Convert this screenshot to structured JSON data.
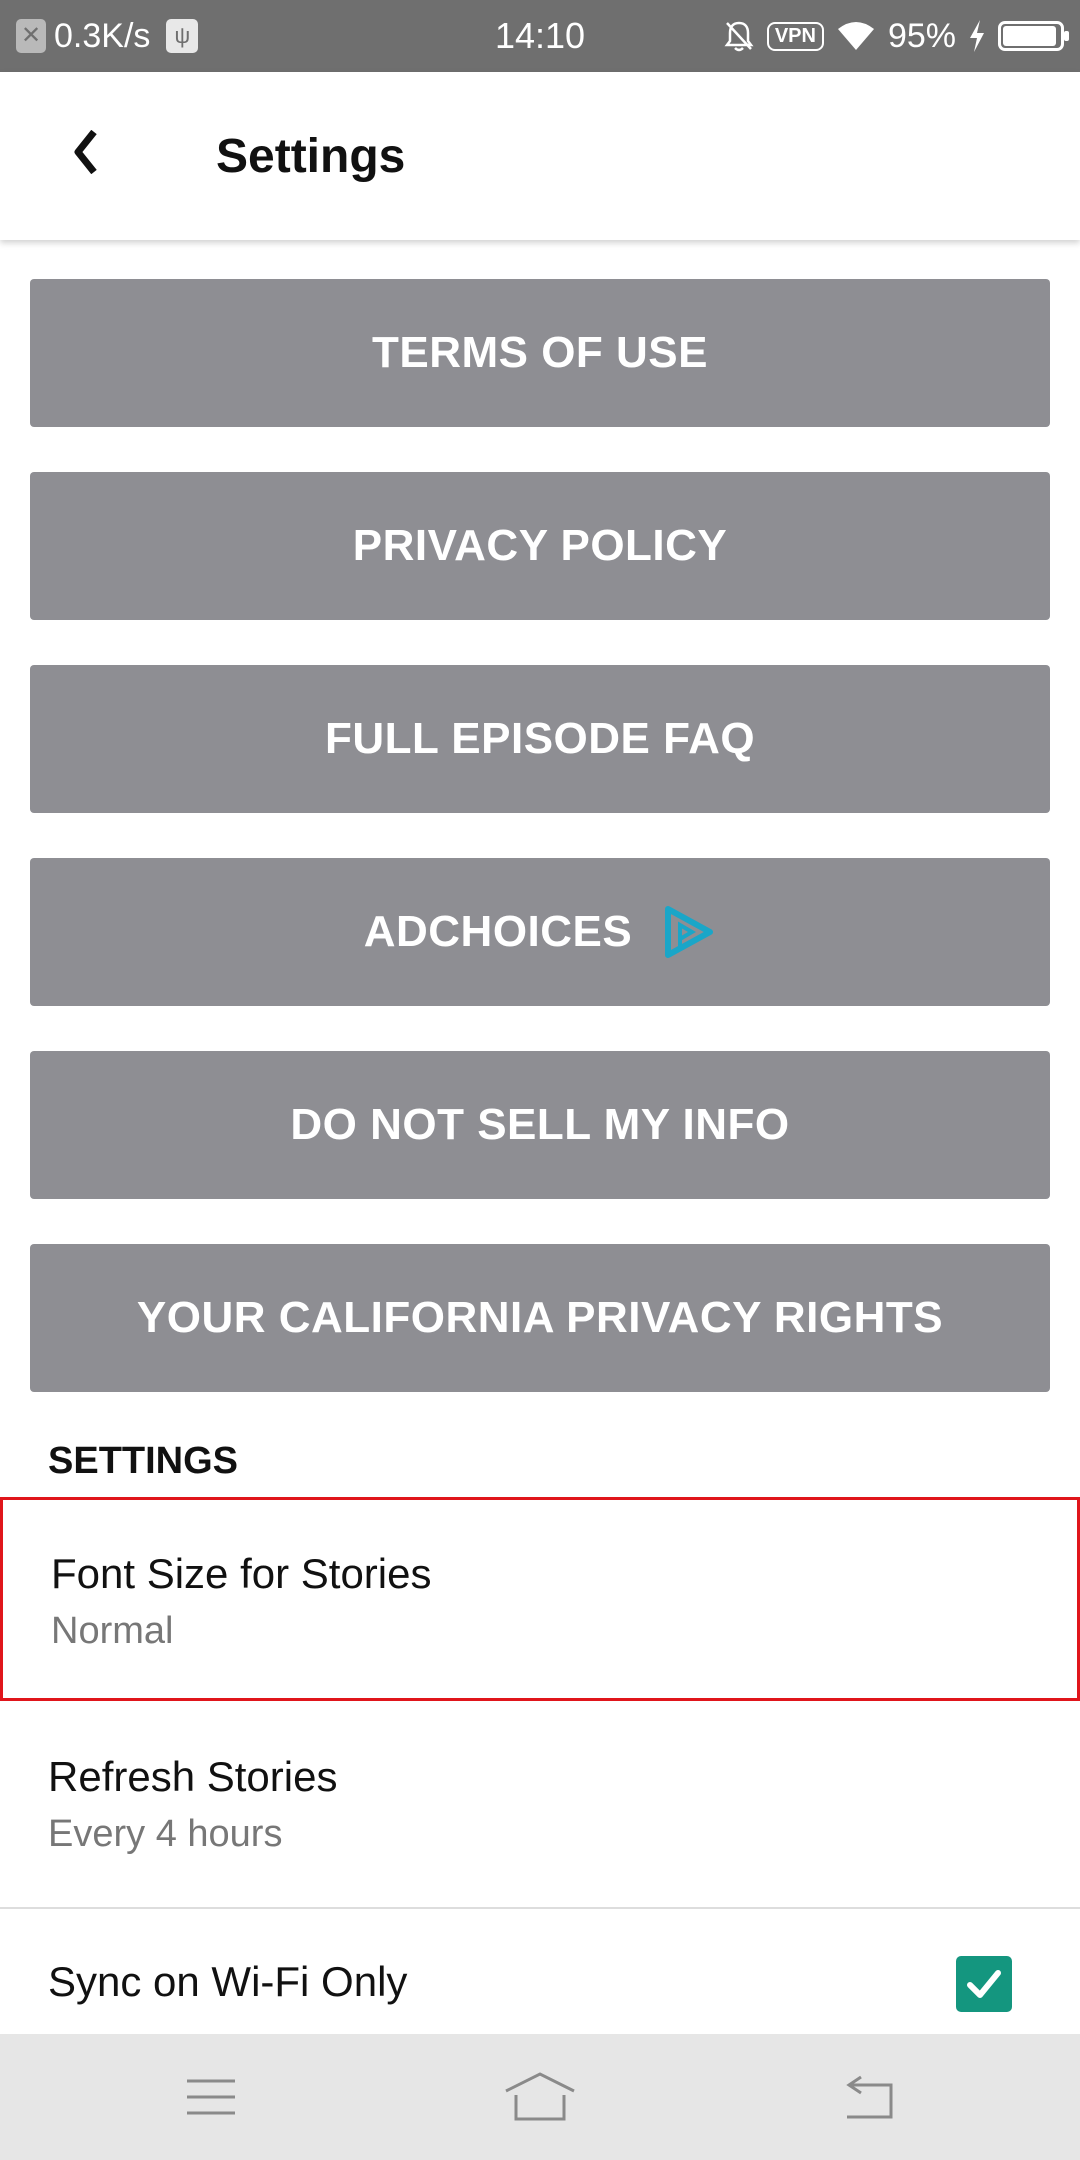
{
  "status_bar": {
    "speed": "0.3K/s",
    "time": "14:10",
    "vpn": "VPN",
    "battery_percent": "95%",
    "battery_level": 0.95,
    "icons": [
      "close-icon",
      "usb-icon",
      "bell-off-icon",
      "vpn-icon",
      "wifi-icon",
      "charging-icon",
      "battery-icon"
    ]
  },
  "header": {
    "title": "Settings",
    "back_icon": "back-arrow-icon"
  },
  "buttons": [
    {
      "label": "TERMS OF USE"
    },
    {
      "label": "PRIVACY POLICY"
    },
    {
      "label": "FULL EPISODE FAQ"
    },
    {
      "label": "ADCHOICES"
    },
    {
      "label": "DO NOT SELL MY INFO"
    },
    {
      "label": "YOUR CALIFORNIA PRIVACY RIGHTS"
    }
  ],
  "settings": {
    "section_title": "SETTINGS",
    "items": [
      {
        "title": "Font Size for Stories",
        "value": "Normal"
      },
      {
        "title": "Refresh Stories",
        "value": "Every 4 hours"
      },
      {
        "title": "Sync on Wi-Fi Only",
        "checked": true
      }
    ]
  },
  "nav_bar": {
    "icons": [
      "menu-icon",
      "home-icon",
      "back-icon"
    ]
  },
  "colors": {
    "status_bar": "#6f6f6f",
    "button_bg": "#8e8e93",
    "adchoices_icon": "#1aa6c8",
    "checkbox": "#14967f",
    "highlight_border": "#e0151b",
    "nav_bar": "#e6e6e6"
  }
}
